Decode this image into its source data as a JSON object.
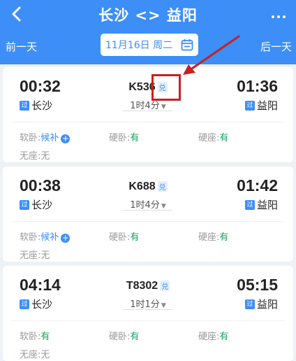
{
  "header": {
    "title": "长沙 <> 益阳",
    "prev_day": "前一天",
    "next_day": "后一天",
    "date": "11月16日 周二"
  },
  "colors": {
    "primary": "#3d8ef7",
    "available": "#1aa260",
    "annotation": "#c82020"
  },
  "labels": {
    "pass_badge": "过",
    "redeem_badge": "兑",
    "plus": "+"
  },
  "trains": [
    {
      "dep_time": "00:32",
      "arr_time": "01:36",
      "train_no": "K536",
      "dep_station": "长沙",
      "arr_station": "益阳",
      "duration": "1时4分",
      "seats": [
        {
          "label": "软卧:",
          "value": "候补",
          "waitlist": true
        },
        {
          "label": "硬卧:",
          "value": "有"
        },
        {
          "label": "硬座:",
          "value": "有"
        },
        {
          "label": "无座:",
          "value": "无"
        }
      ]
    },
    {
      "dep_time": "00:38",
      "arr_time": "01:42",
      "train_no": "K688",
      "dep_station": "长沙",
      "arr_station": "益阳",
      "duration": "1时4分",
      "seats": [
        {
          "label": "软卧:",
          "value": "候补",
          "waitlist": true
        },
        {
          "label": "硬卧:",
          "value": "有"
        },
        {
          "label": "硬座:",
          "value": "有"
        },
        {
          "label": "无座:",
          "value": "无"
        }
      ]
    },
    {
      "dep_time": "04:14",
      "arr_time": "05:15",
      "train_no": "T8302",
      "dep_station": "长沙",
      "arr_station": "益阳",
      "duration": "1时1分",
      "seats": [
        {
          "label": "软卧:",
          "value": "有"
        },
        {
          "label": "硬卧:",
          "value": "有"
        },
        {
          "label": "硬座:",
          "value": "有"
        },
        {
          "label": "无座:",
          "value": "无"
        }
      ]
    }
  ]
}
